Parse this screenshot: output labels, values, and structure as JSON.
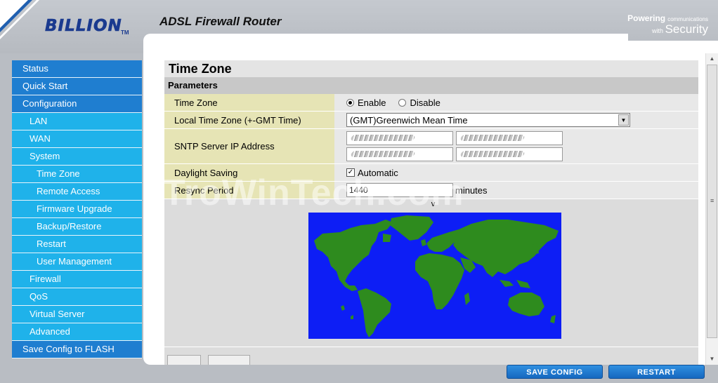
{
  "header": {
    "logo": "BILLION",
    "logo_tm": "TM",
    "product_title": "ADSL Firewall Router",
    "tagline_powering": "Powering",
    "tagline_communications": "communications",
    "tagline_with": "with",
    "tagline_security": "Security"
  },
  "sidebar": {
    "items": [
      {
        "label": "Status",
        "level": 0
      },
      {
        "label": "Quick Start",
        "level": 0
      },
      {
        "label": "Configuration",
        "level": 0
      },
      {
        "label": "LAN",
        "level": 1
      },
      {
        "label": "WAN",
        "level": 1
      },
      {
        "label": "System",
        "level": 1
      },
      {
        "label": "Time Zone",
        "level": 2
      },
      {
        "label": "Remote Access",
        "level": 2
      },
      {
        "label": "Firmware Upgrade",
        "level": 2
      },
      {
        "label": "Backup/Restore",
        "level": 2
      },
      {
        "label": "Restart",
        "level": 2
      },
      {
        "label": "User Management",
        "level": 2
      },
      {
        "label": "Firewall",
        "level": 1
      },
      {
        "label": "QoS",
        "level": 1
      },
      {
        "label": "Virtual Server",
        "level": 1
      },
      {
        "label": "Advanced",
        "level": 1
      },
      {
        "label": "Save Config to FLASH",
        "level": 0
      }
    ]
  },
  "main": {
    "page_title": "Time Zone",
    "section_title": "Parameters",
    "time_zone": {
      "label": "Time Zone",
      "enable_label": "Enable",
      "disable_label": "Disable",
      "selected": "Enable"
    },
    "local_time_zone": {
      "label": "Local Time Zone (+-GMT Time)",
      "value": "(GMT)Greenwich Mean Time"
    },
    "sntp": {
      "label": "SNTP Server IP Address"
    },
    "daylight_saving": {
      "label": "Daylight Saving",
      "option_label": "Automatic",
      "checked": true
    },
    "resync_period": {
      "label": "Resync Period",
      "value": "1440",
      "unit": "minutes"
    },
    "map_marker": "v"
  },
  "watermark": "TroWinTech.com",
  "footer": {
    "save_config": "SAVE CONFIG",
    "restart": "RESTART"
  },
  "colors": {
    "nav_primary": "#1f7ed0",
    "nav_secondary": "#1fb2ea",
    "label_cell": "#e6e4b5",
    "map_ocean": "#0d1ef5",
    "map_land": "#2e8b1e"
  }
}
